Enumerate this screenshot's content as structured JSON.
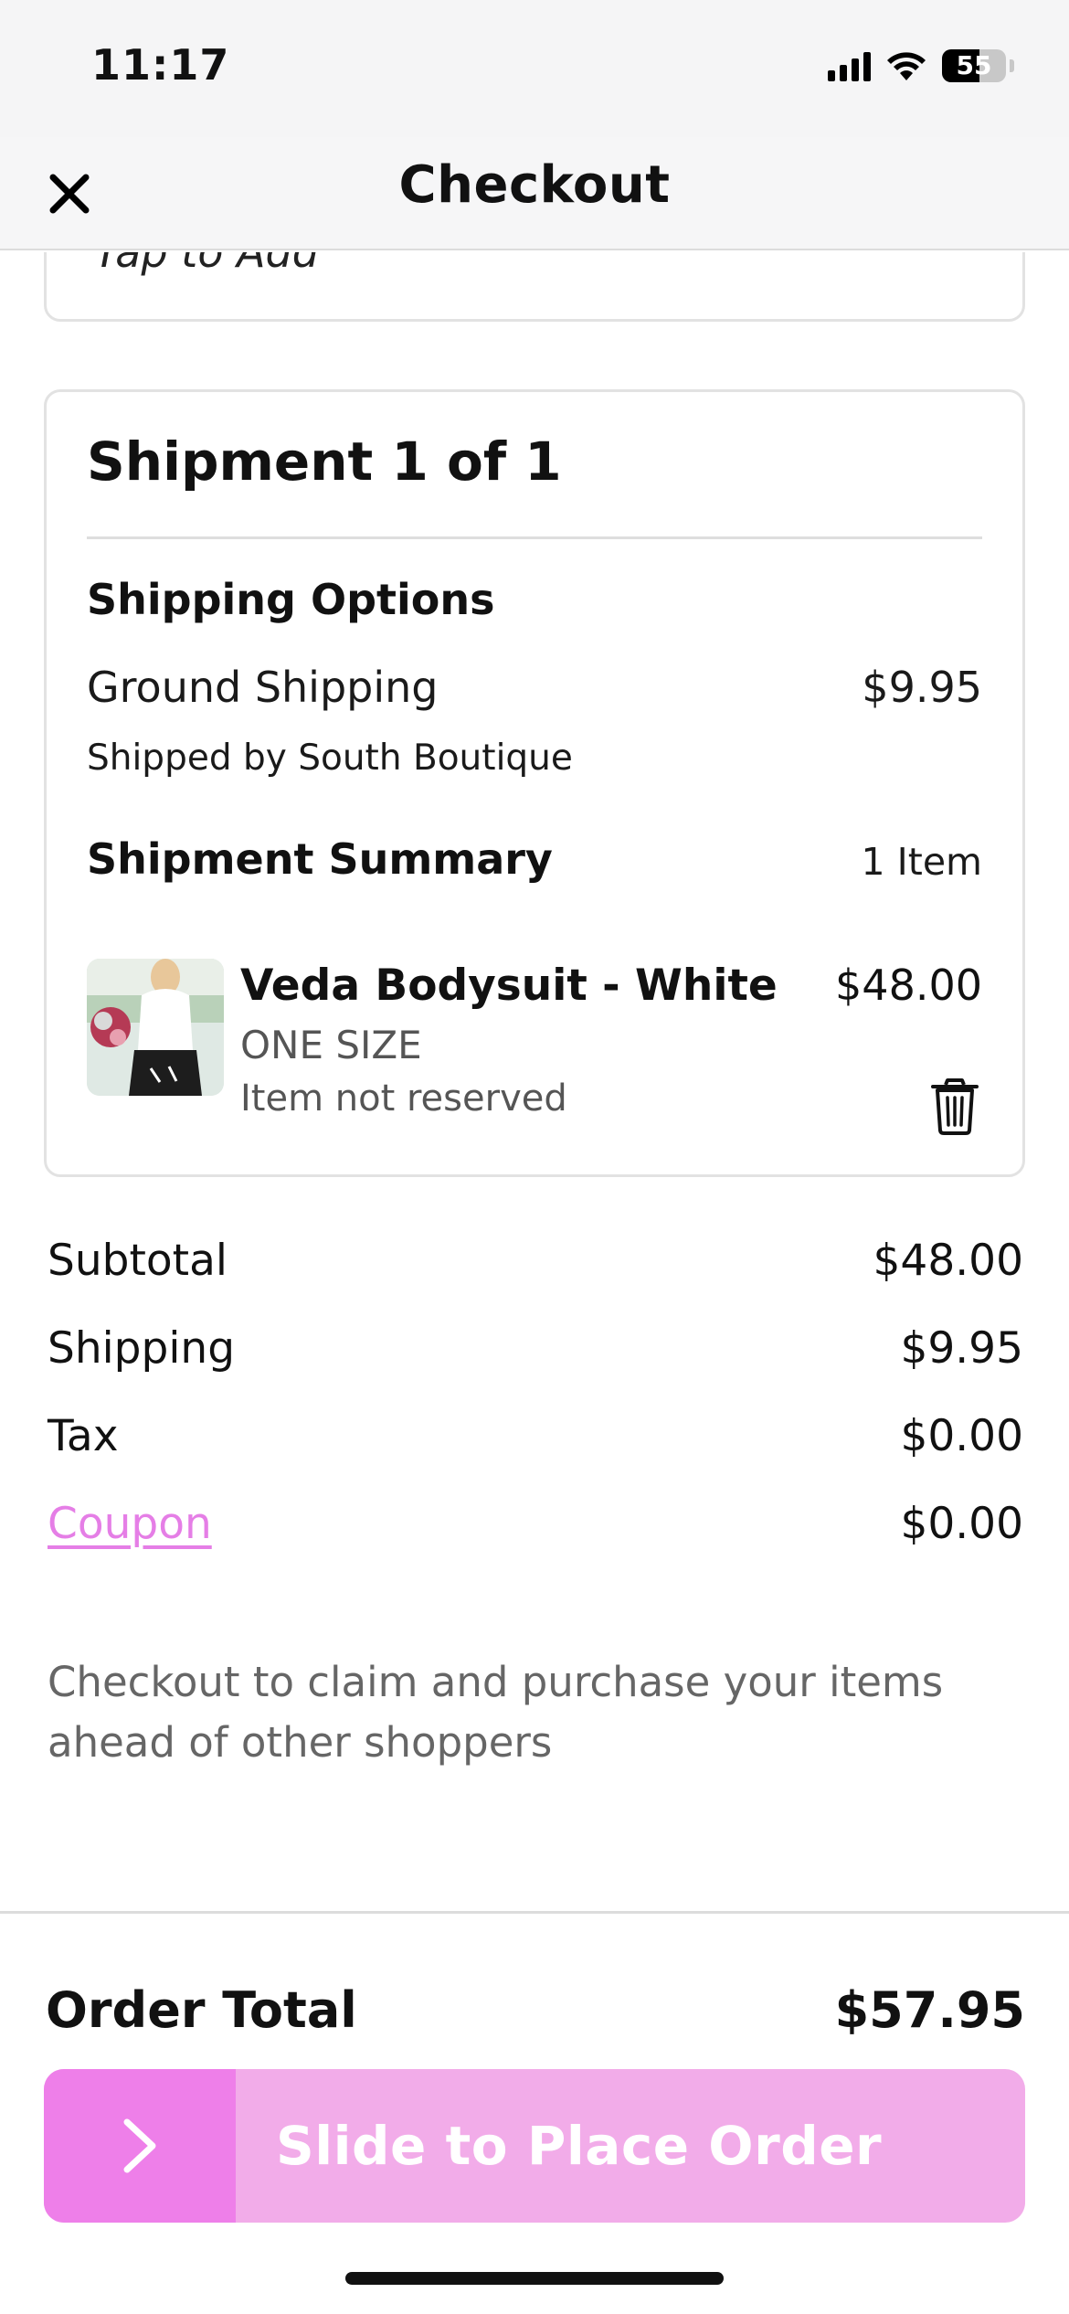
{
  "status_bar": {
    "time": "11:17",
    "battery": "55",
    "icons": [
      "signal-icon",
      "wifi-icon",
      "battery-icon"
    ]
  },
  "header": {
    "title": "Checkout",
    "close_icon": "close-icon"
  },
  "gift_note": {
    "label": "Tap to Add"
  },
  "shipment": {
    "title": "Shipment 1 of 1",
    "shipping_options_title": "Shipping Options",
    "option_name": "Ground Shipping",
    "option_price": "$9.95",
    "shipped_by": "Shipped by South Boutique",
    "summary_title": "Shipment Summary",
    "item_count": "1 Item",
    "item": {
      "name": "Veda Bodysuit - White",
      "size": "ONE SIZE",
      "reservation": "Item not reserved",
      "price": "$48.00",
      "delete_icon": "trash-icon"
    }
  },
  "summary": {
    "subtotal_label": "Subtotal",
    "subtotal_value": "$48.00",
    "shipping_label": "Shipping",
    "shipping_value": "$9.95",
    "tax_label": "Tax",
    "tax_value": "$0.00",
    "coupon_label": "Coupon",
    "coupon_value": "$0.00"
  },
  "note": "Checkout to claim and purchase your items ahead of other shoppers",
  "footer": {
    "total_label": "Order Total",
    "total_value": "$57.95",
    "slider_label": "Slide to Place Order",
    "slider_icon": "chevron-right-icon"
  },
  "colors": {
    "accent": "#ee7fe9",
    "accent_light": "#f2ace9",
    "coupon_link": "#e57ee6"
  }
}
